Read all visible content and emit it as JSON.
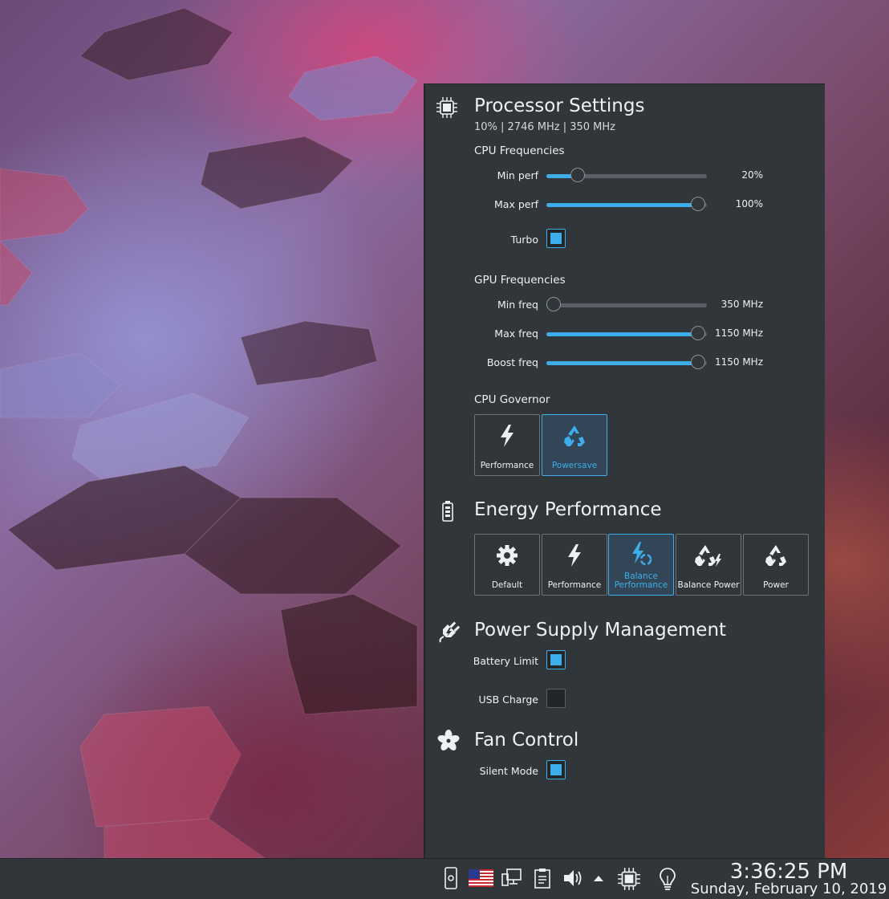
{
  "processor": {
    "title": "Processor Settings",
    "subtitle": "10% | 2746 MHz | 350 MHz",
    "icon": "cpu-chip-icon",
    "cpu_frequencies": {
      "title": "CPU Frequencies",
      "min_perf": {
        "label": "Min perf",
        "value": "20%",
        "level": 0.2
      },
      "max_perf": {
        "label": "Max perf",
        "value": "100%",
        "level": 1.0
      },
      "turbo": {
        "label": "Turbo",
        "checked": true
      }
    },
    "gpu_frequencies": {
      "title": "GPU Frequencies",
      "min_freq": {
        "label": "Min freq",
        "value": "350 MHz",
        "level": 0.0
      },
      "max_freq": {
        "label": "Max freq",
        "value": "1150 MHz",
        "level": 1.0
      },
      "boost_freq": {
        "label": "Boost freq",
        "value": "1150 MHz",
        "level": 1.0
      }
    },
    "cpu_governor": {
      "title": "CPU Governor",
      "options": [
        {
          "label": "Performance",
          "icon": "lightning-icon",
          "active": false
        },
        {
          "label": "Powersave",
          "icon": "recycle-icon",
          "active": true
        }
      ]
    }
  },
  "energy": {
    "title": "Energy Performance",
    "icon": "battery-icon",
    "options": [
      {
        "label": "Default",
        "icon": "gear-icon",
        "active": false
      },
      {
        "label": "Performance",
        "icon": "lightning-icon",
        "active": false
      },
      {
        "label_line1": "Balance",
        "label_line2": "Performance",
        "icon": "lightning-recycle-icon",
        "active": true
      },
      {
        "label": "Balance Power",
        "icon": "recycle-lightning-icon",
        "active": false
      },
      {
        "label": "Power",
        "icon": "recycle-icon",
        "active": false
      }
    ]
  },
  "power_supply": {
    "title": "Power Supply Management",
    "icon": "plug-icon",
    "battery_limit": {
      "label": "Battery Limit",
      "checked": true
    },
    "usb_charge": {
      "label": "USB Charge",
      "checked": false
    }
  },
  "fan": {
    "title": "Fan Control",
    "icon": "fan-icon",
    "silent_mode": {
      "label": "Silent Mode",
      "checked": true
    }
  },
  "taskbar": {
    "tray_icons": [
      "phone-settings-icon",
      "us-flag-icon",
      "network-icon",
      "clipboard-icon",
      "volume-icon",
      "expand-tray-icon",
      "cpu-chip-icon",
      "lightbulb-icon"
    ],
    "clock_time": "3:36:25 PM",
    "clock_date": "Sunday, February 10, 2019"
  },
  "colors": {
    "accent": "#3daee9",
    "panel_bg": "#31363b",
    "text": "#eff0f1"
  }
}
